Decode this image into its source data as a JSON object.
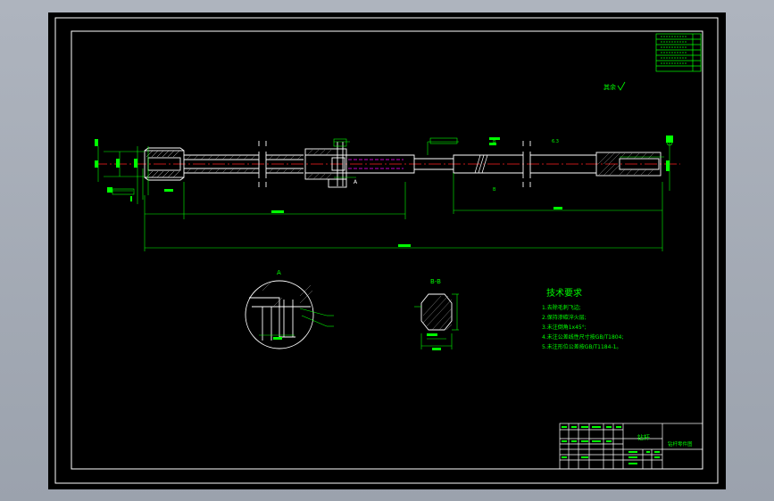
{
  "drawing": {
    "tech_requirements": {
      "title": "技术要求",
      "items": [
        "1.去除毛刺飞边;",
        "2.保持渗碳淬火层;",
        "3.未注倒角1x45°;",
        "4.未注公差线性尺寸按GB/T1804;",
        "5.未注形位公差按GB/T1184-1。"
      ]
    },
    "section_labels": {
      "top_note": "其余",
      "detail_a": "A",
      "detail_b": "B-B"
    },
    "title_block": {
      "part_name": "钻杆",
      "drawing_title": "钻杆零件图"
    },
    "colors": {
      "outline": "#ffffff",
      "dimension": "#00ff00",
      "centerline": "#ff2020",
      "hidden": "#ff00ff",
      "sheet": "#000000",
      "viewport": "#a3aab5"
    }
  }
}
